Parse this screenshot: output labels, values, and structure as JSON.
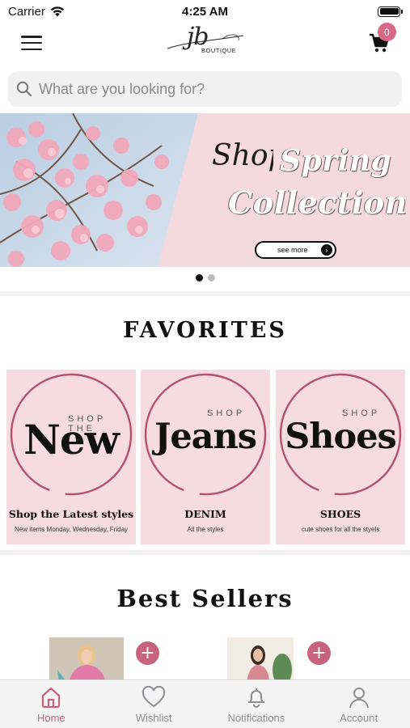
{
  "status_bar": {
    "carrier": "Carrier",
    "time": "4:25 AM"
  },
  "header": {
    "logo_text": "jb",
    "logo_subtext": "BOUTIQUE",
    "cart_count": "0"
  },
  "search": {
    "placeholder": "What are you looking for?"
  },
  "banner": {
    "script": "Shop",
    "title_line1": "Spring",
    "title_line2": "Collection",
    "button_label": "see more",
    "slides": 2,
    "active_slide": 1
  },
  "favorites": {
    "title": "FAVORITES",
    "cards": [
      {
        "small": "SHOP THE",
        "big": "New",
        "caption": "Shop the Latest styles",
        "subcaption": "New items Monday, Wednesday, Friday"
      },
      {
        "small": "SHOP",
        "big": "Jeans",
        "caption": "DENIM",
        "subcaption": "All the styles"
      },
      {
        "small": "SHOP",
        "big": "Shoes",
        "caption": "SHOES",
        "subcaption": "cute shoes for all the styels"
      }
    ]
  },
  "best_sellers": {
    "title": "Best Sellers",
    "add_label": "+"
  },
  "tabs": [
    {
      "label": "Home",
      "icon": "home-icon",
      "active": true
    },
    {
      "label": "Wishlist",
      "icon": "heart-icon",
      "active": false
    },
    {
      "label": "Notifications",
      "icon": "bell-icon",
      "active": false
    },
    {
      "label": "Account",
      "icon": "person-icon",
      "active": false
    }
  ],
  "colors": {
    "accent": "#c8637f",
    "card_pink": "#f6dce2",
    "banner_pink": "#f4d9df"
  }
}
